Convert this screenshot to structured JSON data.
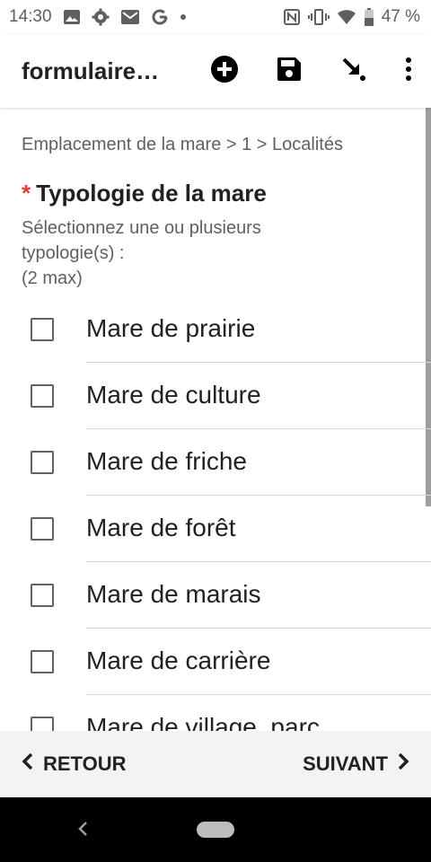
{
  "status_bar": {
    "time": "14:30",
    "battery": "47 %"
  },
  "app_bar": {
    "title": "formulaire…"
  },
  "breadcrumb": "Emplacement de la mare > 1 > Localités",
  "question": {
    "required_marker": "*",
    "title": "Typologie de la mare",
    "hint_line1": "Sélectionnez une ou plusieurs",
    "hint_line2": "typologie(s) :",
    "hint_line3": "(2 max)"
  },
  "options": [
    "Mare de prairie",
    "Mare de culture",
    "Mare de friche",
    "Mare de forêt",
    "Mare de marais",
    "Mare de carrière",
    "Mare de village, parc"
  ],
  "navigation": {
    "back_label": "RETOUR",
    "next_label": "SUIVANT"
  },
  "icons": {
    "add": "add-circle-icon",
    "save": "save-icon",
    "finalize": "arrow-down-right-icon",
    "more": "more-vert-icon"
  }
}
